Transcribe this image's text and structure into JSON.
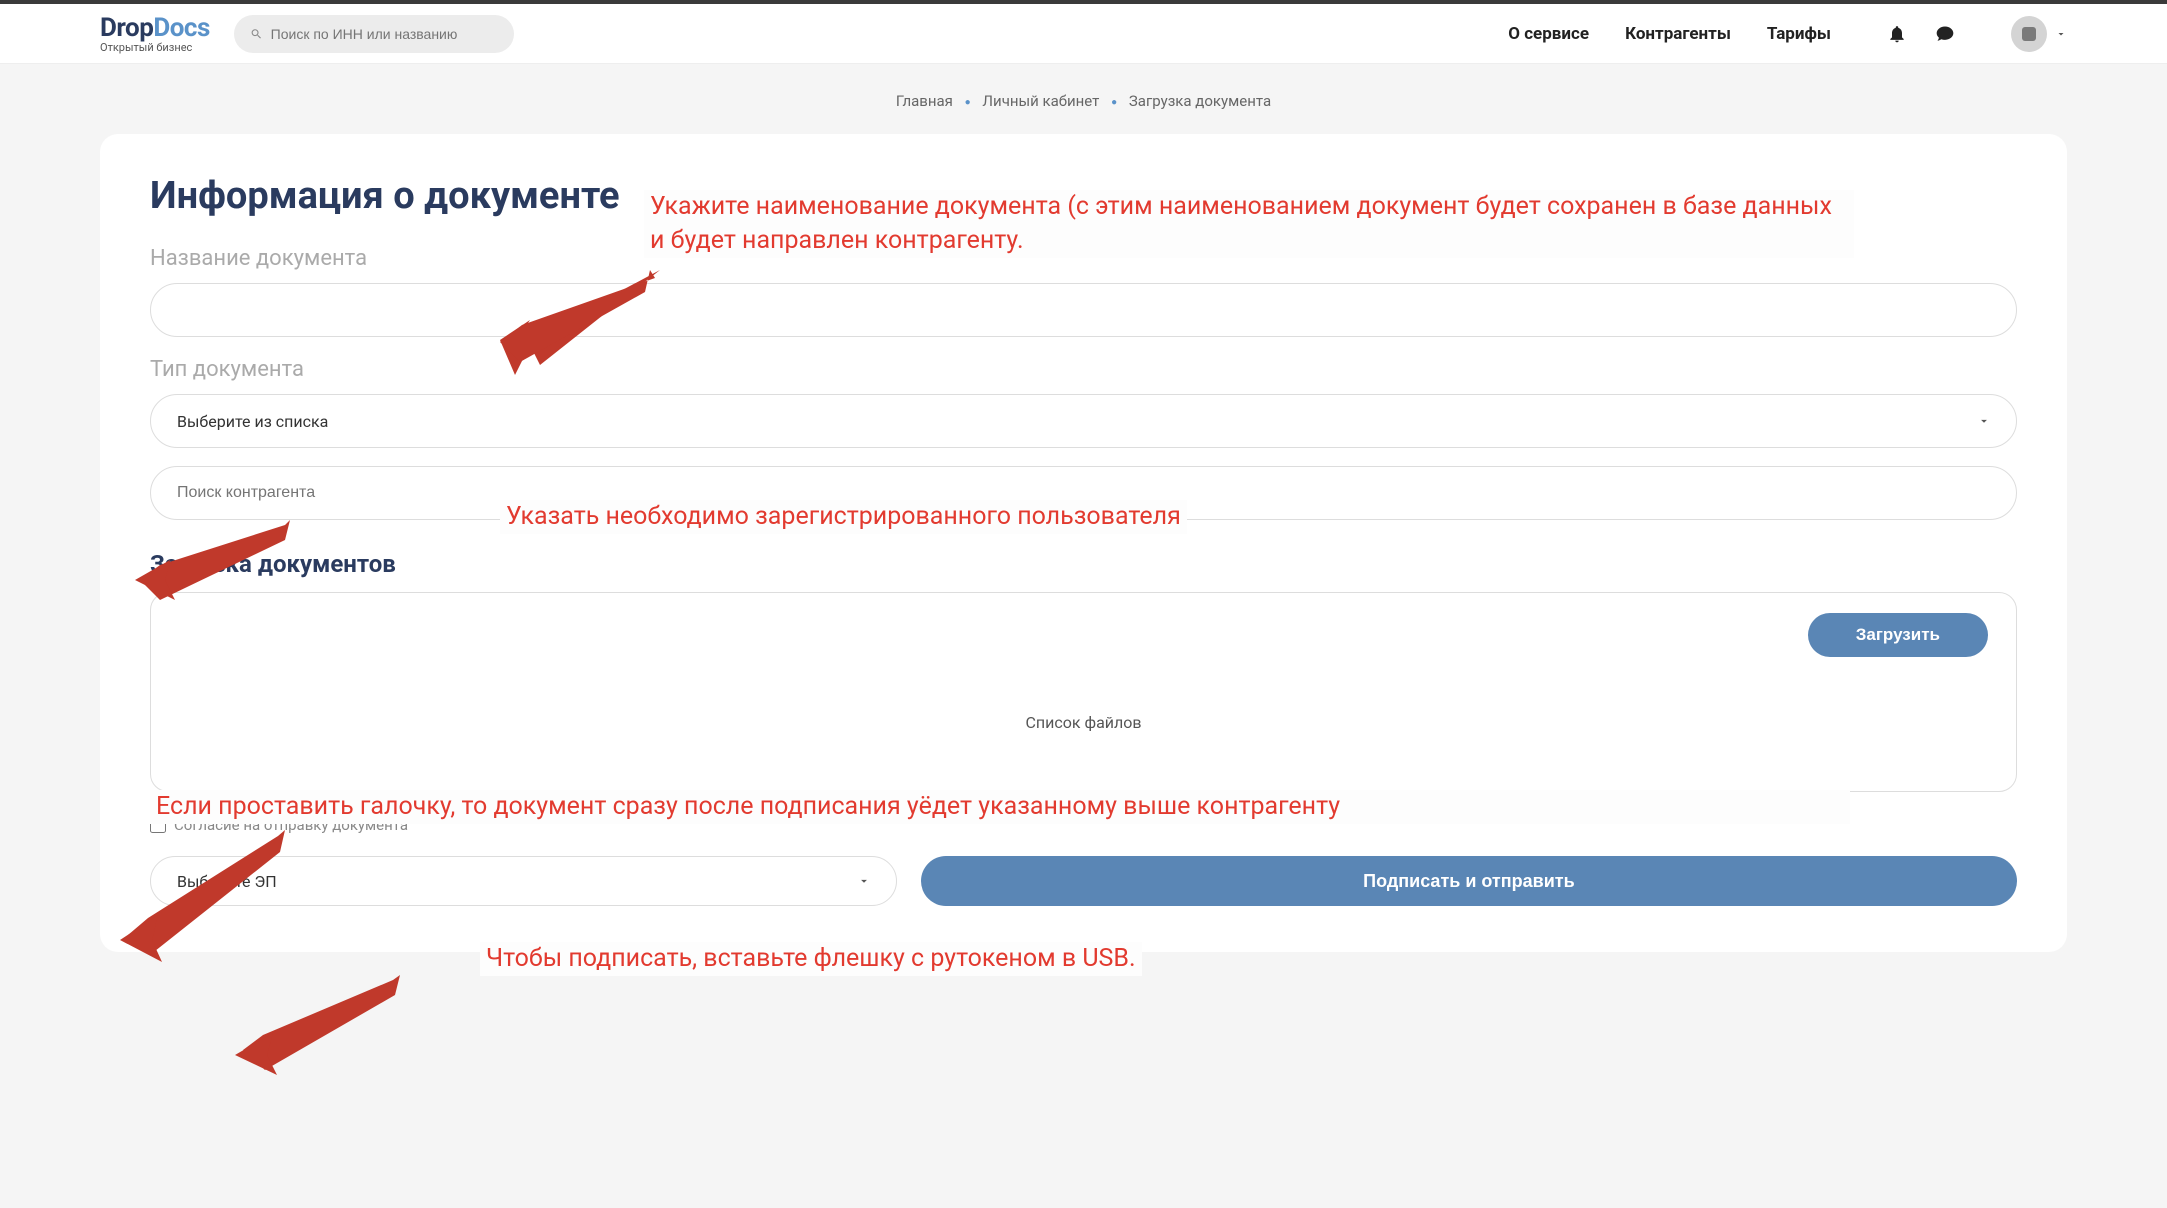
{
  "logo": {
    "part1": "Drop",
    "part2": "Docs",
    "sub": "Открытый бизнес"
  },
  "search": {
    "placeholder": "Поиск по ИНН или названию"
  },
  "nav": {
    "about": "О сервисе",
    "contragents": "Контрагенты",
    "tariffs": "Тарифы"
  },
  "breadcrumb": {
    "home": "Главная",
    "cabinet": "Личный кабинет",
    "upload": "Загрузка документа"
  },
  "card": {
    "title": "Информация о документе",
    "doc_name_label": "Название документа",
    "doc_type_label": "Тип документа",
    "doc_type_placeholder": "Выберите из списка",
    "contragent_placeholder": "Поиск контрагента",
    "upload_section": "Загрузка документов",
    "upload_btn": "Загрузить",
    "file_list": "Список файлов",
    "consent": "Согласие на отправку документа",
    "select_ep": "Выберите ЭП",
    "submit": "Подписать и отправить"
  },
  "annotations": {
    "a1": "Укажите наименование документа (с этим наименованием документ будет сохранен в базе данных и будет направлен контрагенту.",
    "a2": "Указать необходимо зарегистрированного пользователя",
    "a3": "Если проставить галочку, то документ сразу после подписания уёдет указанному выше контрагенту",
    "a4": "Чтобы подписать, вставьте флешку с рутокеном в USB."
  }
}
